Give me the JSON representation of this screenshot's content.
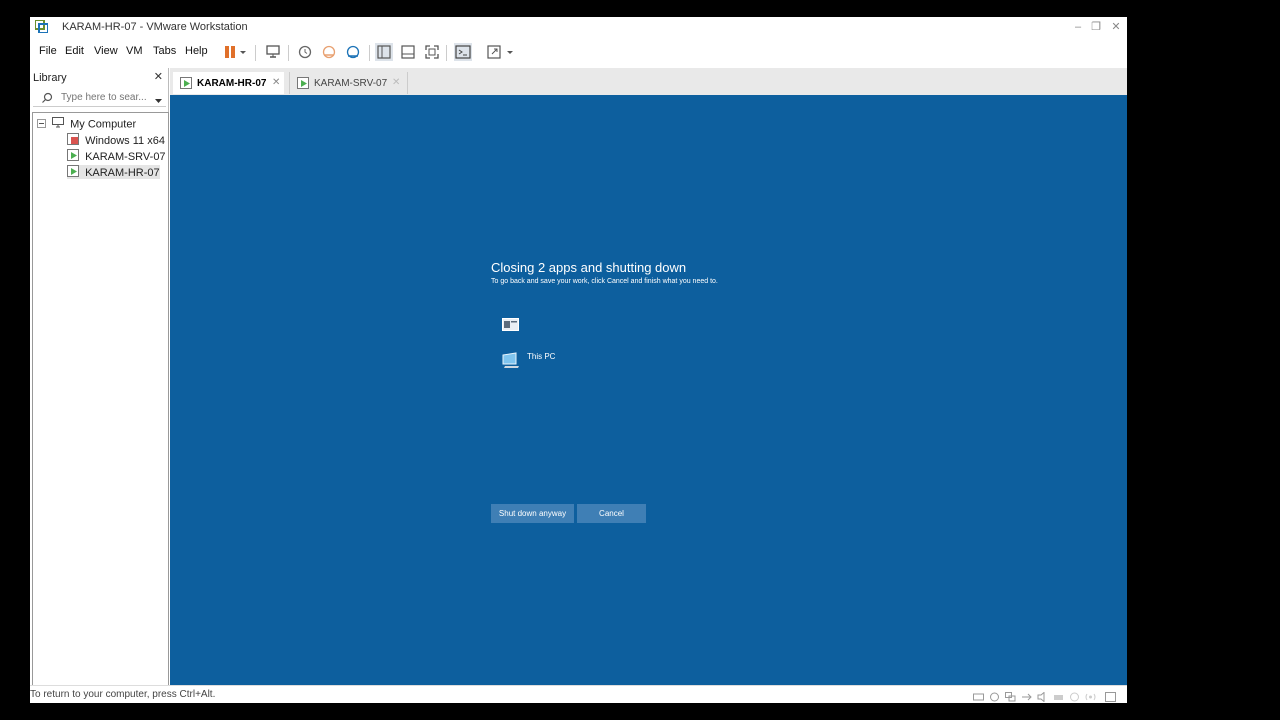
{
  "window": {
    "title": "KARAM-HR-07 - VMware Workstation"
  },
  "menubar": {
    "items": [
      "File",
      "Edit",
      "View",
      "VM",
      "Tabs",
      "Help"
    ]
  },
  "library": {
    "header": "Library",
    "search_placeholder": "Type here to sear...",
    "tree": {
      "root": "My Computer",
      "items": [
        "Windows 11 x64",
        "KARAM-SRV-07",
        "KARAM-HR-07"
      ]
    }
  },
  "tabs": [
    {
      "label": "KARAM-HR-07",
      "active": true
    },
    {
      "label": "KARAM-SRV-07",
      "active": false
    }
  ],
  "vm": {
    "heading": "Closing 2 apps and shutting down",
    "subheading": "To go back and save your work, click Cancel and finish what you need to.",
    "apps": [
      {
        "label": ""
      },
      {
        "label": "This PC"
      }
    ],
    "shutdown_button": "Shut down anyway",
    "cancel_button": "Cancel",
    "background_color": "#0d5f9e"
  },
  "statusbar": {
    "text": "To return to your computer, press Ctrl+Alt."
  }
}
